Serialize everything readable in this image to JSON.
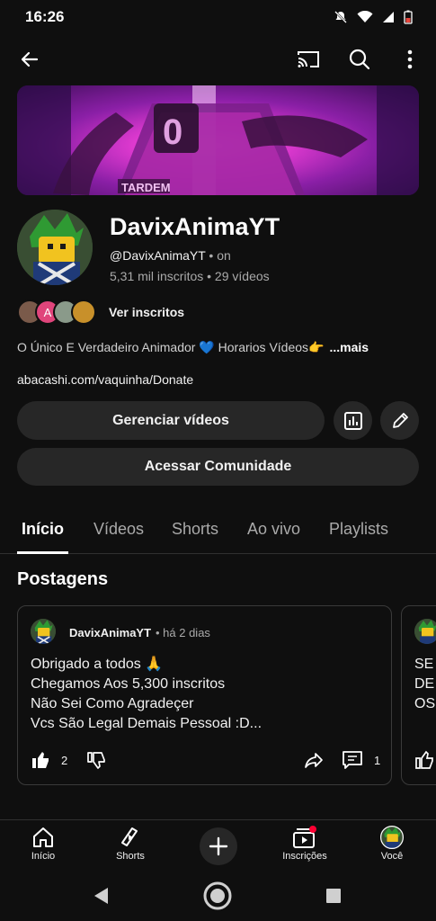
{
  "status": {
    "time": "16:26"
  },
  "channel": {
    "name": "DavixAnimaYT",
    "handle": "@DavixAnimaYT",
    "handle_suffix": " • on",
    "stats": "5,31 mil inscritos • 29 vídeos",
    "subs_label": "Ver inscritos",
    "subscriber_initial": "A",
    "description": "O Único E Verdadeiro Animador 💙 Horarios Vídeos👉",
    "description_more": "...mais",
    "link": "abacashi.com/vaquinha/Donate",
    "banner_text": "TARDEM"
  },
  "buttons": {
    "manage_videos": "Gerenciar vídeos",
    "community": "Acessar Comunidade"
  },
  "tabs": [
    {
      "label": "Início"
    },
    {
      "label": "Vídeos"
    },
    {
      "label": "Shorts"
    },
    {
      "label": "Ao vivo"
    },
    {
      "label": "Playlists"
    }
  ],
  "section_title": "Postagens",
  "post": {
    "author": "DavixAnimaYT",
    "time": "• há 2 dias",
    "lines": [
      "Obrigado a todos 🙏",
      "Chegamos Aos 5,300 inscritos",
      "Não Sei Como Agradeçer",
      "Vcs São Legal Demais Pessoal :D..."
    ],
    "likes": "2",
    "comments": "1"
  },
  "post2_snippet": [
    "SE",
    "DE",
    "OS"
  ],
  "bottom_nav": [
    {
      "label": "Início",
      "icon": "home-icon"
    },
    {
      "label": "Shorts",
      "icon": "shorts-icon"
    },
    {
      "label": "Inscrições",
      "icon": "subscriptions-icon"
    },
    {
      "label": "Você",
      "icon": "you-avatar"
    }
  ]
}
